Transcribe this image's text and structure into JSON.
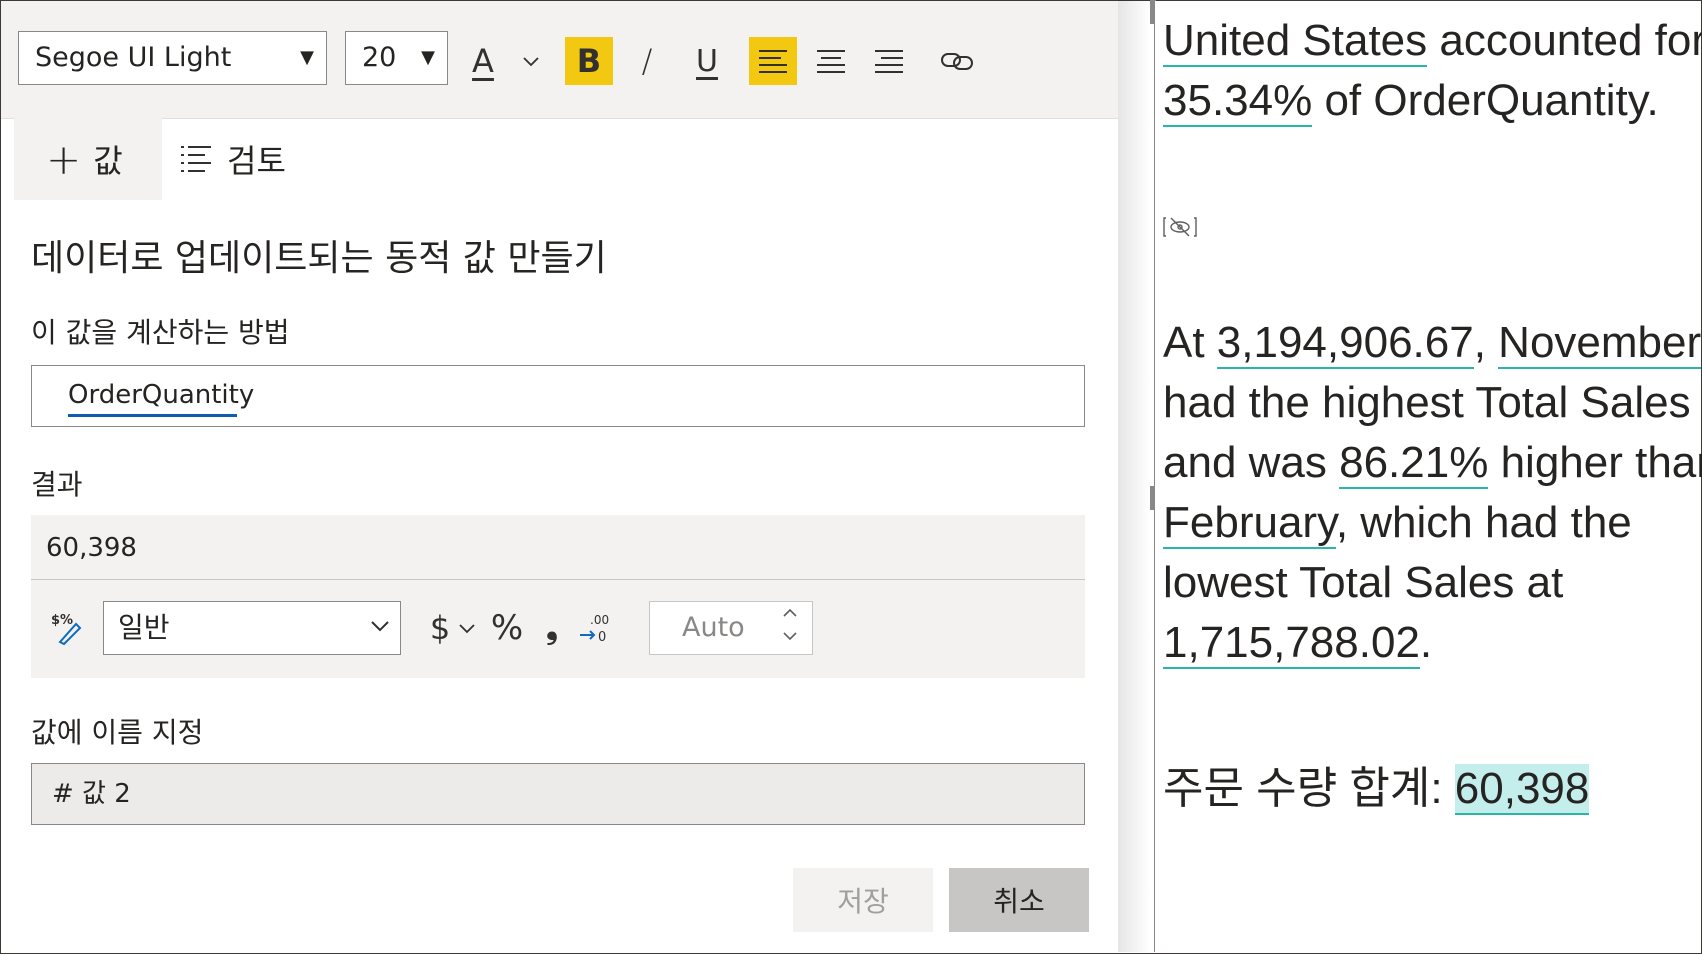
{
  "toolbar": {
    "font_name": "Segoe UI Light",
    "font_size": "20",
    "icons": [
      "font-color-icon",
      "chevron-down-icon",
      "bold-icon",
      "italic-icon",
      "underline-icon",
      "align-left-icon",
      "align-center-icon",
      "align-right-icon",
      "link-icon"
    ],
    "bold_label": "B",
    "italic_label": "/",
    "font_color_label": "A",
    "underline_label": "U",
    "active_color": "#f2c811"
  },
  "tabs": {
    "add_value": "값",
    "review": "검토"
  },
  "form": {
    "heading": "데이터로 업데이트되는 동적 값 만들기",
    "calc_label": "이 값을 계산하는 방법",
    "calc_value": "OrderQuantity",
    "result_label": "결과",
    "result_value": "60,398",
    "format_select": "일반",
    "currency_symbol": "$",
    "percent_symbol": "%",
    "comma_symbol": "❟",
    "decimal_placeholder": "Auto",
    "name_label": "값에 이름 지정",
    "name_value": "# 값 2",
    "save_label": "저장",
    "cancel_label": "취소"
  },
  "narrative": {
    "p1_line1_a": "United States",
    "p1_line1_b": " accounted for",
    "p1_line2_a": "35.34%",
    "p1_line2_b": " of OrderQuantity.",
    "p2_line1_a": "At ",
    "p2_line1_b": "3,194,906.67",
    "p2_line1_c": ", ",
    "p2_line1_d": "November",
    "p2_line2": "had the highest Total Sales",
    "p2_line3_a": "and was ",
    "p2_line3_b": "86.21%",
    "p2_line3_c": " higher than",
    "p2_line4_a": "February",
    "p2_line4_b": ", which had the",
    "p2_line5": "lowest Total Sales at",
    "p2_line6_a": "1,715,788.02",
    "p2_line6_b": ".",
    "p3_label": "주문 수량 합계: ",
    "p3_value": "60,398",
    "accent_color": "#2bb5a8",
    "highlight_color": "#c4eeec"
  }
}
